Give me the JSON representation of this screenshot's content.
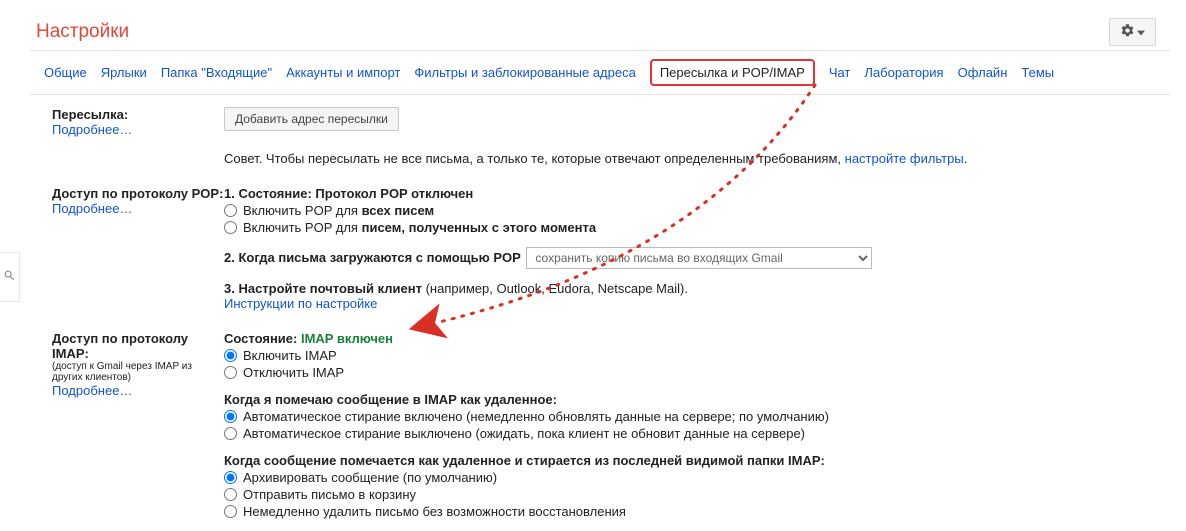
{
  "header": {
    "title": "Настройки"
  },
  "tabs": {
    "general": "Общие",
    "labels": "Ярлыки",
    "inbox": "Папка \"Входящие\"",
    "accounts": "Аккаунты и импорт",
    "filters": "Фильтры и заблокированные адреса",
    "forwarding": "Пересылка и POP/IMAP",
    "chat": "Чат",
    "labs": "Лаборатория",
    "offline": "Офлайн",
    "themes": "Темы"
  },
  "forwarding": {
    "title": "Пересылка:",
    "more": "Подробнее…",
    "add_button": "Добавить адрес пересылки",
    "tip_prefix": "Совет. Чтобы пересылать не все письма, а только те, которые отвечают определенным требованиям, ",
    "tip_link": "настройте фильтры",
    "tip_suffix": "."
  },
  "pop": {
    "title": "Доступ по протоколу POP:",
    "more": "Подробнее…",
    "status_label": "1. Состояние: Протокол POP отключен",
    "opt_all_prefix": "Включить POP для ",
    "opt_all_bold": "всех писем",
    "opt_new_prefix": "Включить POP для ",
    "opt_new_bold": "писем, полученных с этого момента",
    "step2": "2. Когда письма загружаются с помощью POP",
    "select_value": "сохранить копию письма во входящих Gmail",
    "step3_prefix": "3. Настройте почтовый клиент",
    "step3_suffix": " (например, Outlook, Eudora, Netscape Mail).",
    "instructions": "Инструкции по настройке"
  },
  "imap": {
    "title": "Доступ по протоколу IMAP:",
    "subtitle": "(доступ к Gmail через IMAP из других клиентов)",
    "more": "Подробнее…",
    "status_label": "Состояние:",
    "status_value": "IMAP включен",
    "enable": "Включить IMAP",
    "disable": "Отключить IMAP",
    "delete_heading": "Когда я помечаю сообщение в IMAP как удаленное:",
    "auto_on": "Автоматическое стирание включено (немедленно обновлять данные на сервере; по умолчанию)",
    "auto_off": "Автоматическое стирание выключено (ожидать, пока клиент не обновит данные на сервере)",
    "expunge_heading": "Когда сообщение помечается как удаленное и стирается из последней видимой папки IMAP:",
    "expunge_archive": "Архивировать сообщение (по умолчанию)",
    "expunge_trash": "Отправить письмо в корзину",
    "expunge_delete": "Немедленно удалить письмо без возможности восстановления"
  }
}
